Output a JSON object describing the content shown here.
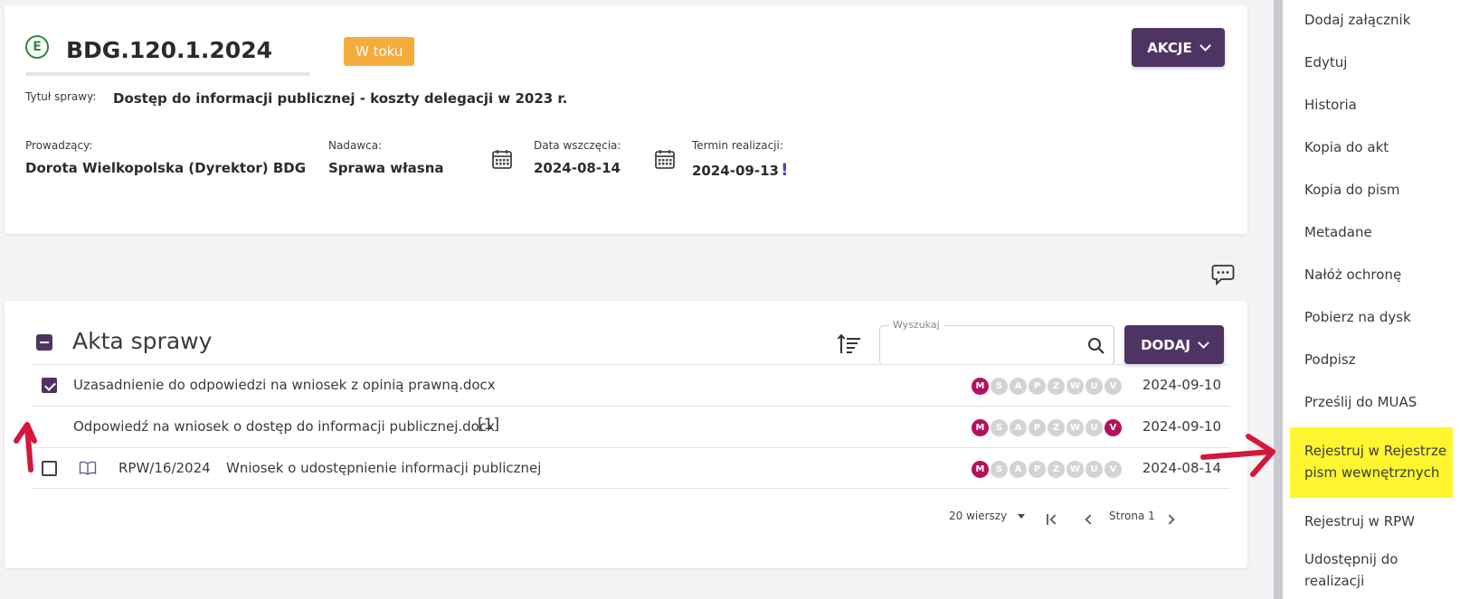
{
  "case": {
    "icon_letter": "E",
    "number": "BDG.120.1.2024",
    "status": "W toku",
    "actions_button": "AKCJE",
    "title_label": "Tytuł sprawy:",
    "title_value": "Dostęp do informacji publicznej - koszty delegacji w 2023 r.",
    "owner_label": "Prowadzący:",
    "owner_value": "Dorota Wielkopolska (Dyrektor) BDG",
    "sender_label": "Nadawca:",
    "sender_value": "Sprawa własna",
    "start_label": "Data wszczęcia:",
    "start_value": "2024-08-14",
    "deadline_label": "Termin realizacji:",
    "deadline_value": "2024-09-13",
    "deadline_mark": "!"
  },
  "akta": {
    "title": "Akta sprawy",
    "search_legend": "Wyszukaj",
    "search_value": "",
    "add_button": "DODAJ",
    "rows": [
      {
        "checked": true,
        "name": "Uzasadnienie do odpowiedzi na wniosek z opinią prawną.docx",
        "count": "",
        "flags_on": [
          "M"
        ],
        "date": "2024-09-10"
      },
      {
        "checked": false,
        "name": "Odpowiedź na wniosek o dostęp do informacji publicznej.docx",
        "count": "[1]",
        "flags_on": [
          "M",
          "V"
        ],
        "date": "2024-09-10"
      },
      {
        "checked": false,
        "rpw": "RPW/16/2024",
        "name": "Wniosek o udostępnienie informacji publicznej",
        "count": "",
        "flags_on": [
          "M"
        ],
        "date": "2024-08-14"
      }
    ],
    "flag_letters": [
      "M",
      "S",
      "A",
      "P",
      "Z",
      "W",
      "U",
      "V"
    ],
    "pager": {
      "rows_per_page": "20 wierszy",
      "page": "Strona 1"
    }
  },
  "side_menu": {
    "items": [
      "Dodaj załącznik",
      "Edytuj",
      "Historia",
      "Kopia do akt",
      "Kopia do pism",
      "Metadane",
      "Nałóż ochronę",
      "Pobierz na dysk",
      "Podpisz",
      "Prześlij do MUAS",
      "Rejestruj w Rejestrze pism wewnętrznych",
      "Rejestruj w RPW",
      "Udostępnij do realizacji"
    ],
    "highlighted": "Rejestruj w Rejestrze pism wewnętrznych"
  },
  "colors": {
    "accent": "#4e3462",
    "status": "#f6ac3d",
    "flag_on": "#b3115f",
    "highlight": "#fff62f",
    "annotation": "#d4173b"
  }
}
